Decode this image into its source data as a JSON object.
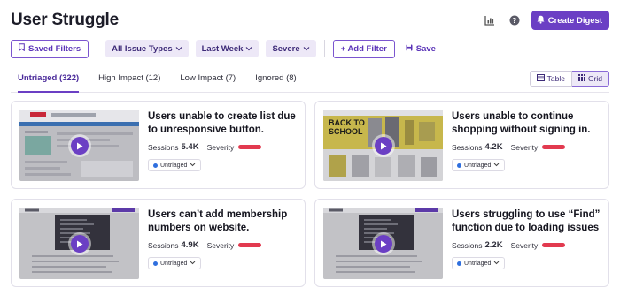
{
  "header": {
    "title": "User Struggle",
    "digest_label": "Create Digest"
  },
  "filters": {
    "saved": "Saved Filters",
    "issue_types": "All Issue Types",
    "period": "Last Week",
    "severity": "Severe",
    "add": "+ Add Filter",
    "save": "Save"
  },
  "tabs": [
    {
      "label": "Untriaged (322)",
      "active": true
    },
    {
      "label": "High Impact (12)"
    },
    {
      "label": "Low Impact (7)"
    },
    {
      "label": "Ignored (8)"
    }
  ],
  "view": {
    "table": "Table",
    "grid": "Grid"
  },
  "labels": {
    "sessions": "Sessions",
    "severity": "Severity"
  },
  "cards": [
    {
      "title": "Users unable to create list due to unresponsive button.",
      "sessions": "5.4K",
      "status": "Untriaged"
    },
    {
      "title": "Users unable to continue shopping without signing in.",
      "sessions": "4.2K",
      "status": "Untriaged",
      "banner": "BACK TO SCHOOL"
    },
    {
      "title": "Users can’t add membership numbers on website.",
      "sessions": "4.9K",
      "status": "Untriaged"
    },
    {
      "title": "Users struggling to use “Find” function due to loading issues",
      "sessions": "2.2K",
      "status": "Untriaged"
    }
  ],
  "colors": {
    "accent": "#6b3fc4",
    "severity": "#e23a4f",
    "status_dot": "#2f6fde"
  }
}
